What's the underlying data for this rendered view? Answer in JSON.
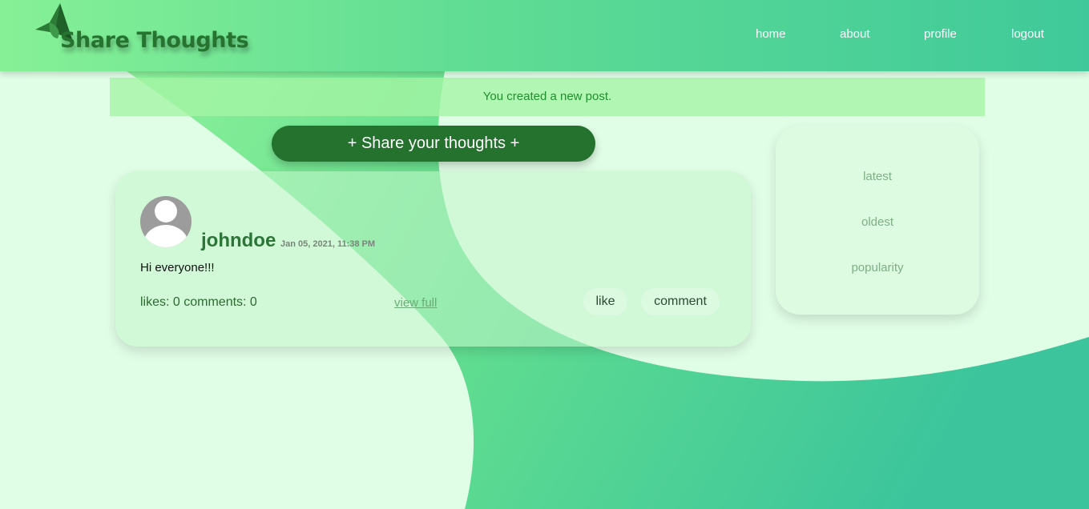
{
  "brand": {
    "title": "Share Thoughts",
    "logo_icon": "paper-plane-icon"
  },
  "nav": {
    "home": "home",
    "about": "about",
    "profile": "profile",
    "logout": "logout"
  },
  "alert": {
    "message": "You created a new post."
  },
  "share_button": {
    "label": "+ Share your thoughts +"
  },
  "post": {
    "username": "johndoe",
    "date": "Jan 05, 2021, 11:38 PM",
    "body": "Hi everyone!!!",
    "stats": "likes: 0 comments: 0",
    "view_full": "view full",
    "like_label": "like",
    "comment_label": "comment",
    "avatar_icon": "user-avatar-icon"
  },
  "sort": {
    "latest": "latest",
    "oldest": "oldest",
    "popularity": "popularity"
  },
  "colors": {
    "brand_dark_green": "#25712e",
    "nav_gradient_start": "#86f096",
    "nav_gradient_end": "#3fc99a",
    "page_background": "#e0fde6"
  }
}
